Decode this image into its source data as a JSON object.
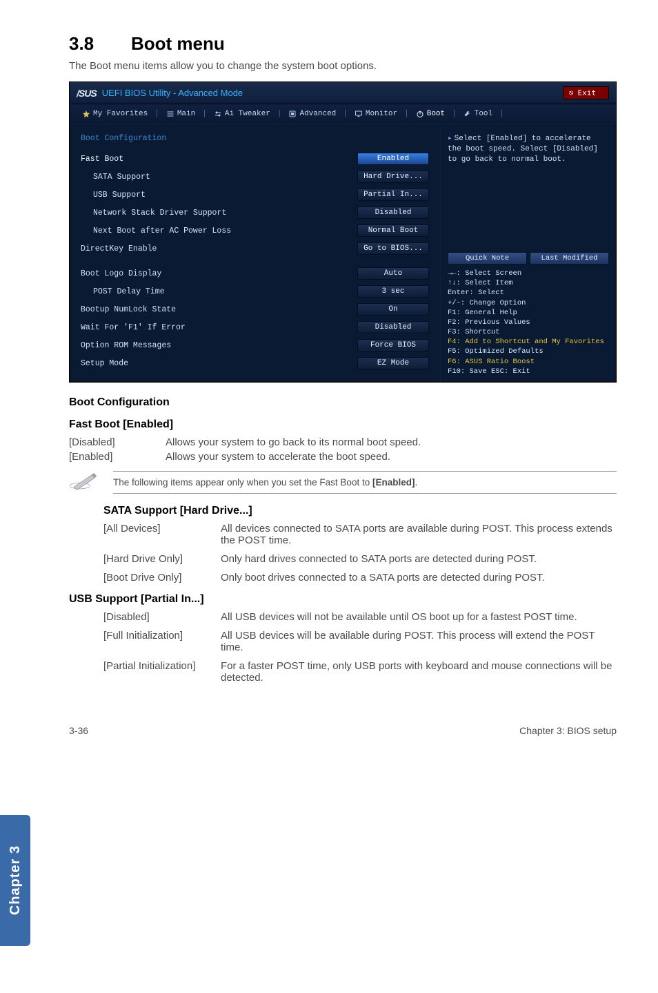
{
  "section": {
    "number": "3.8",
    "title": "Boot menu"
  },
  "intro": "The Boot menu items allow you to change the system boot options.",
  "bios": {
    "brand": "/SUS",
    "title": "UEFI BIOS Utility - Advanced Mode",
    "exit_label": "Exit",
    "exit_icon": "⎋",
    "tabs": {
      "favorites": "My Favorites",
      "main": "Main",
      "tweaker": "Ai Tweaker",
      "advanced": "Advanced",
      "monitor": "Monitor",
      "boot": "Boot",
      "tool": "Tool"
    },
    "group_title": "Boot Configuration",
    "rows": {
      "fast_boot": {
        "label": "Fast Boot",
        "value": "Enabled"
      },
      "sata": {
        "label": "SATA Support",
        "value": "Hard Drive..."
      },
      "usb": {
        "label": "USB Support",
        "value": "Partial In..."
      },
      "net": {
        "label": "Network Stack Driver Support",
        "value": "Disabled"
      },
      "nextboot": {
        "label": "Next Boot after AC Power Loss",
        "value": "Normal Boot"
      },
      "directkey": {
        "label": "DirectKey Enable",
        "value": "Go to BIOS..."
      },
      "logo": {
        "label": "Boot Logo Display",
        "value": "Auto"
      },
      "postdelay": {
        "label": "POST Delay Time",
        "value": "3 sec"
      },
      "numlock": {
        "label": "Bootup NumLock State",
        "value": "On"
      },
      "waitf1": {
        "label": "Wait For 'F1' If Error",
        "value": "Disabled"
      },
      "rommsg": {
        "label": "Option ROM Messages",
        "value": "Force BIOS"
      },
      "setup": {
        "label": "Setup Mode",
        "value": "EZ Mode"
      }
    },
    "right_desc": "Select [Enabled] to accelerate the boot speed. Select [Disabled] to go back to normal boot.",
    "quick_note": "Quick Note",
    "last_modified": "Last Modified",
    "help": {
      "l1": "→←: Select Screen",
      "l2": "↑↓: Select Item",
      "l3": "Enter: Select",
      "l4": "+/-: Change Option",
      "l5": "F1: General Help",
      "l6": "F2: Previous Values",
      "l7": "F3: Shortcut",
      "l8": "F4: Add to Shortcut and My Favorites",
      "l9": "F5: Optimized Defaults",
      "l10": "F6: ASUS Ratio Boost",
      "l11": "F10: Save   ESC: Exit"
    }
  },
  "boot_conf_heading": "Boot Configuration",
  "fast_boot_heading": "Fast Boot [Enabled]",
  "fb_disabled_key": "[Disabled]",
  "fb_disabled_val": "Allows your system to go back to its normal boot speed.",
  "fb_enabled_key": "[Enabled]",
  "fb_enabled_val": "Allows your system to accelerate the boot speed.",
  "note_text_1": "The following items appear only when you set the Fast Boot to ",
  "note_bold": "[Enabled]",
  "note_text_2": ".",
  "sata_heading": "SATA Support [Hard Drive...]",
  "sata_all_k": "[All Devices]",
  "sata_all_v": "All devices connected to SATA ports are available during POST. This process extends the POST time.",
  "sata_hd_k": "[Hard Drive Only]",
  "sata_hd_v": "Only hard drives connected to SATA ports are detected during POST.",
  "sata_bd_k": "[Boot Drive Only]",
  "sata_bd_v": "Only boot drives connected to a SATA ports are detected during POST.",
  "usb_heading": "USB Support [Partial In...]",
  "usb_dis_k": "[Disabled]",
  "usb_dis_v": "All USB devices will not be available until OS boot up for a fastest POST time.",
  "usb_full_k": "[Full Initialization]",
  "usb_full_v": "All USB devices will be available during POST. This process will extend the POST time.",
  "usb_part_k": "[Partial Initialization]",
  "usb_part_v": "For a faster POST time, only USB ports with keyboard and mouse connections will be detected.",
  "side_tab": "Chapter 3",
  "footer_left": "3-36",
  "footer_right": "Chapter 3: BIOS setup"
}
